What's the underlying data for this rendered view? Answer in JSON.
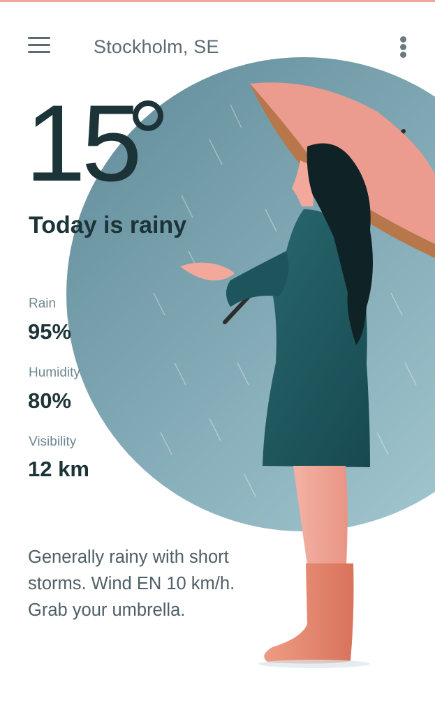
{
  "header": {
    "location": "Stockholm, SE"
  },
  "current": {
    "temperature": "15",
    "condition": "Today is rainy"
  },
  "stats": [
    {
      "label": "Rain",
      "value": "95%"
    },
    {
      "label": "Humidity",
      "value": "80%"
    },
    {
      "label": "Visibility",
      "value": "12 km"
    }
  ],
  "summary": "Generally rainy with short storms. Wind EN 10 km/h. Grab your umbrella.",
  "icons": {
    "menu": "hamburger-menu-icon",
    "more": "vertical-dots-icon"
  },
  "colors": {
    "accent": "#f2a79a",
    "text_dark": "#1c3338",
    "text_muted": "#6d8690",
    "circle": "#6f97a4",
    "coat": "#1f5a60",
    "umbrella": "#ec9c8f",
    "skin": "#f0a496",
    "boots": "#e58a72"
  }
}
